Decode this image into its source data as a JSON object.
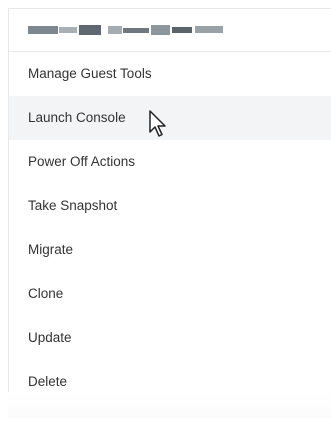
{
  "menu": {
    "items": [
      {
        "label": "Manage Guest Tools"
      },
      {
        "label": "Launch Console"
      },
      {
        "label": "Power Off Actions"
      },
      {
        "label": "Take Snapshot"
      },
      {
        "label": "Migrate"
      },
      {
        "label": "Clone"
      },
      {
        "label": "Update"
      },
      {
        "label": "Delete"
      }
    ],
    "hovered_item": "Launch Console"
  },
  "colors": {
    "hover_background": "#f3f4f5",
    "text": "#333333",
    "divider": "#e6e8ea"
  },
  "icons": {
    "pointer": "mouse-pointer-icon"
  }
}
